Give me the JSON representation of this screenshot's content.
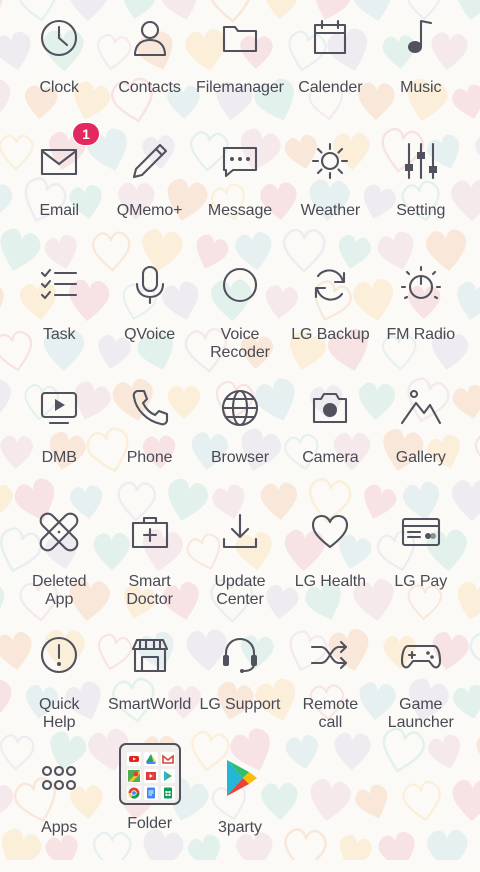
{
  "badge_color": "#e2285e",
  "icon_color": "#52525e",
  "apps": [
    {
      "label": "Clock",
      "icon": "clock-icon"
    },
    {
      "label": "Contacts",
      "icon": "person-icon"
    },
    {
      "label": "Filemanager",
      "icon": "folder-outline-icon"
    },
    {
      "label": "Calender",
      "icon": "calendar-icon"
    },
    {
      "label": "Music",
      "icon": "music-note-icon"
    },
    {
      "label": "Email",
      "icon": "envelope-icon",
      "badge": "1"
    },
    {
      "label": "QMemo+",
      "icon": "pen-icon"
    },
    {
      "label": "Message",
      "icon": "chat-bubble-icon"
    },
    {
      "label": "Weather",
      "icon": "sun-icon"
    },
    {
      "label": "Setting",
      "icon": "sliders-icon"
    },
    {
      "label": "Task",
      "icon": "checklist-icon"
    },
    {
      "label": "QVoice",
      "icon": "microphone-icon"
    },
    {
      "label": "Voice\nRecoder",
      "icon": "record-circle-icon"
    },
    {
      "label": "LG Backup",
      "icon": "sync-icon"
    },
    {
      "label": "FM Radio",
      "icon": "radio-dial-icon"
    },
    {
      "label": "DMB",
      "icon": "tv-play-icon"
    },
    {
      "label": "Phone",
      "icon": "phone-icon"
    },
    {
      "label": "Browser",
      "icon": "globe-icon"
    },
    {
      "label": "Camera",
      "icon": "camera-icon"
    },
    {
      "label": "Gallery",
      "icon": "mountain-icon"
    },
    {
      "label": "Deleted\nApp",
      "icon": "bandage-icon"
    },
    {
      "label": "Smart\nDoctor",
      "icon": "medkit-icon"
    },
    {
      "label": "Update\nCenter",
      "icon": "download-icon"
    },
    {
      "label": "LG Health",
      "icon": "heart-icon"
    },
    {
      "label": "LG Pay",
      "icon": "credit-card-icon"
    },
    {
      "label": "Quick\nHelp",
      "icon": "exclamation-circle-icon"
    },
    {
      "label": "SmartWorld",
      "icon": "store-icon"
    },
    {
      "label": "LG Support",
      "icon": "headset-icon"
    },
    {
      "label": "Remote\ncall",
      "icon": "shuffle-icon"
    },
    {
      "label": "Game\nLauncher",
      "icon": "gamepad-icon"
    },
    {
      "label": "Apps",
      "icon": "dots-grid-icon"
    },
    {
      "label": "Folder",
      "icon": "app-folder-icon"
    },
    {
      "label": "3party",
      "icon": "play-store-icon"
    }
  ],
  "folder_apps": [
    "youtube",
    "drive",
    "gmail",
    "maps",
    "play-movies",
    "play-store",
    "chrome",
    "docs",
    "sheets"
  ]
}
